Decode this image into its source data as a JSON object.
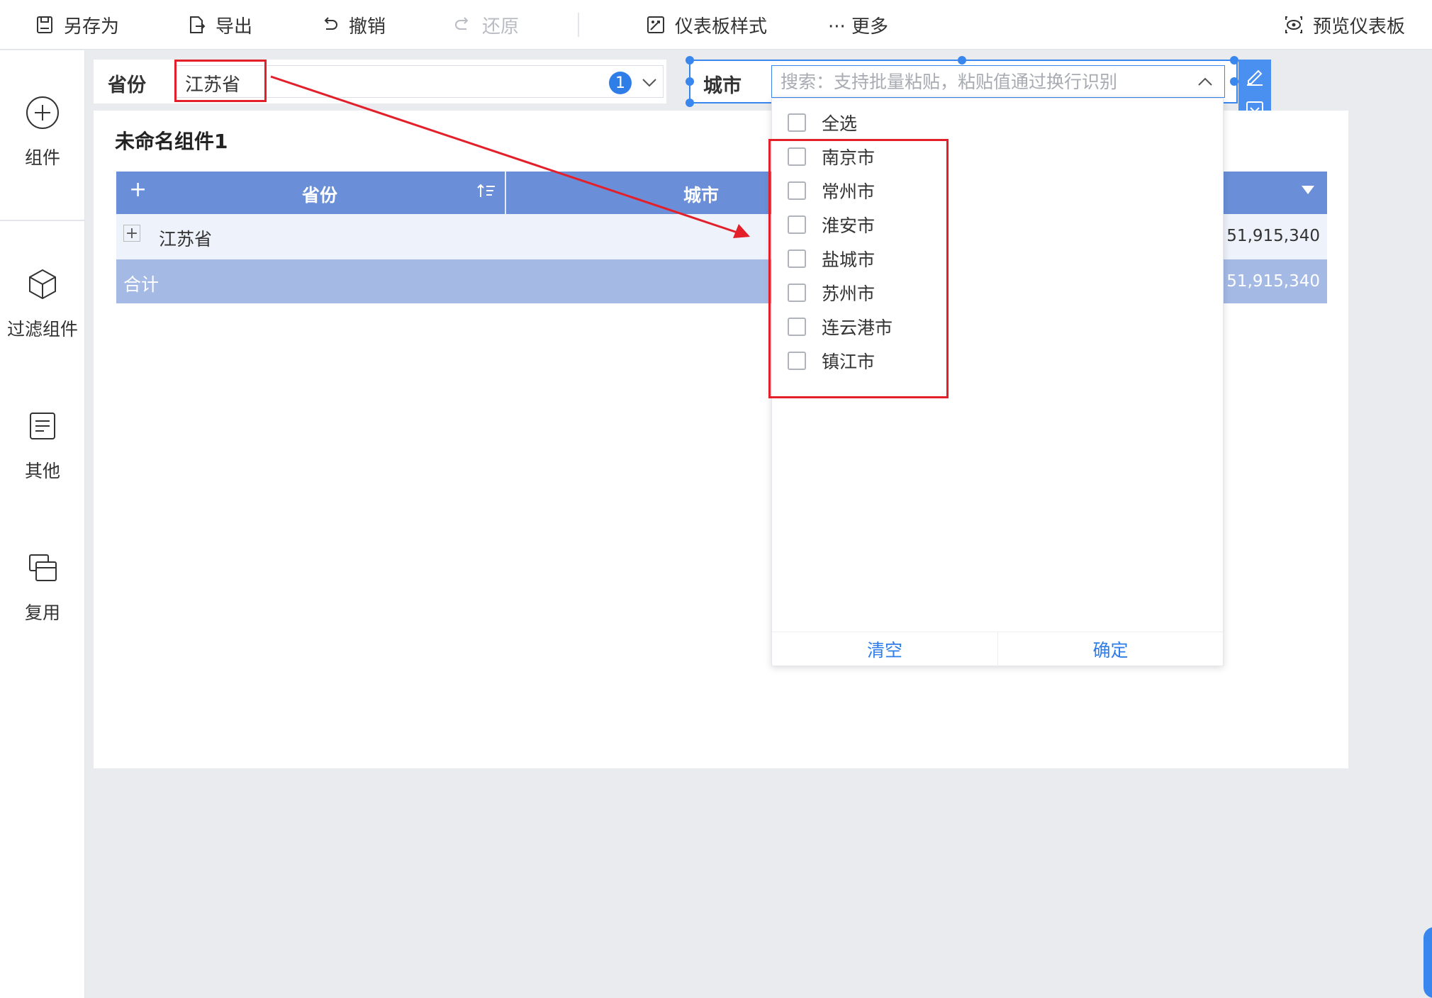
{
  "toolbar": {
    "save_as": "另存为",
    "export": "导出",
    "undo": "撤销",
    "redo": "还原",
    "dashboard_style": "仪表板样式",
    "more": "··· 更多",
    "preview": "预览仪表板"
  },
  "sidebar": {
    "components": "组件",
    "filter_components": "过滤组件",
    "other": "其他",
    "reuse": "复用"
  },
  "filter_province": {
    "label": "省份",
    "value": "江苏省",
    "selected_count": "1"
  },
  "filter_city": {
    "label": "城市",
    "search_placeholder": "搜索：支持批量粘贴，粘贴值通过换行识别"
  },
  "widget": {
    "title": "未命名组件1",
    "table": {
      "add_symbol": "+",
      "col_province": "省份",
      "col_city": "城市",
      "row_province": "江苏省",
      "row_value": "51,915,340",
      "total_label": "合计",
      "total_value": "51,915,340"
    }
  },
  "dropdown": {
    "select_all": "全选",
    "options": [
      "南京市",
      "常州市",
      "淮安市",
      "盐城市",
      "苏州市",
      "连云港市",
      "镇江市"
    ],
    "clear": "清空",
    "confirm": "确定"
  },
  "colors": {
    "accent": "#2f7ee8",
    "table_header": "#6a8fd8",
    "total_row": "#a4bae5",
    "annotation": "#e3202a"
  }
}
